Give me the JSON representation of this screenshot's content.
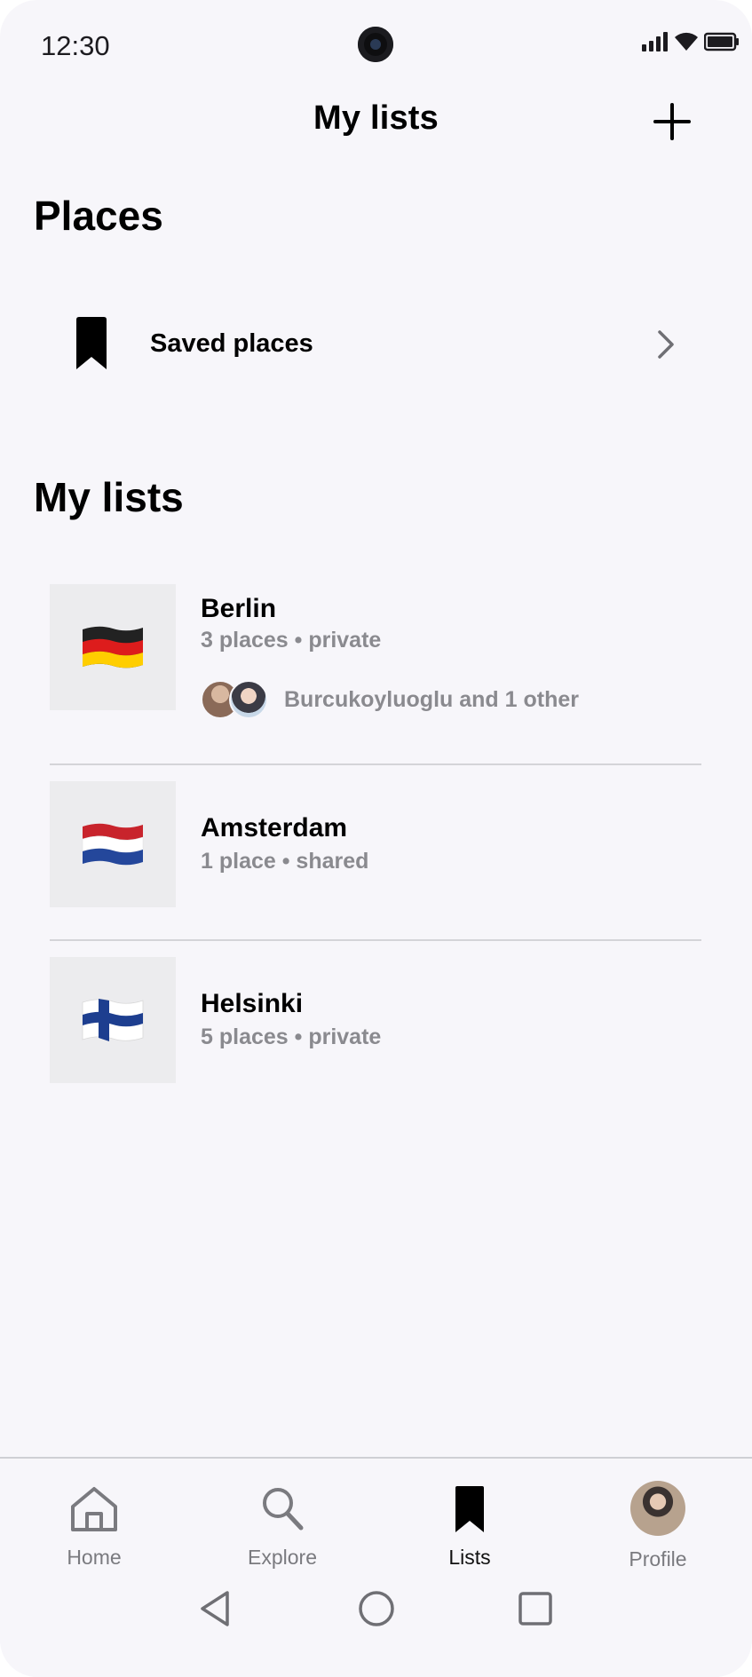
{
  "status_bar": {
    "time": "12:30"
  },
  "header": {
    "title": "My lists",
    "add_icon": "plus-icon"
  },
  "places_section": {
    "title": "Places",
    "saved_places": {
      "label": "Saved places",
      "icon": "bookmark-icon",
      "chevron": "chevron-right-icon"
    }
  },
  "lists_section": {
    "title": "My lists",
    "items": [
      {
        "name": "Berlin",
        "meta": "3 places • private",
        "flag": "germany-flag",
        "collaborators": "Burcukoyluoglu and 1 other"
      },
      {
        "name": "Amsterdam",
        "meta": "1 place • shared",
        "flag": "netherlands-flag"
      },
      {
        "name": "Helsinki",
        "meta": "5 places • private",
        "flag": "finland-flag"
      }
    ]
  },
  "bottom_nav": {
    "items": [
      {
        "label": "Home",
        "icon": "home-icon"
      },
      {
        "label": "Explore",
        "icon": "search-icon"
      },
      {
        "label": "Lists",
        "icon": "bookmark-icon",
        "active": true
      },
      {
        "label": "Profile",
        "icon": "avatar"
      }
    ]
  },
  "colors": {
    "background": "#f7f6fa",
    "text": "#000000",
    "muted": "#8a8a8f",
    "divider": "#d4d4d8"
  }
}
